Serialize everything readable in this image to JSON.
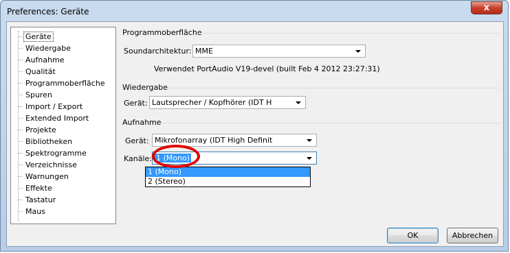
{
  "window": {
    "title": "Preferences: Geräte",
    "close_label": "x"
  },
  "tree": {
    "items": [
      {
        "label": "Geräte"
      },
      {
        "label": "Wiedergabe"
      },
      {
        "label": "Aufnahme"
      },
      {
        "label": "Qualität"
      },
      {
        "label": "Programmoberfläche"
      },
      {
        "label": "Spuren"
      },
      {
        "label": "Import / Export"
      },
      {
        "label": "Extended Import"
      },
      {
        "label": "Projekte"
      },
      {
        "label": "Bibliotheken"
      },
      {
        "label": "Spektrogramme"
      },
      {
        "label": "Verzeichnisse"
      },
      {
        "label": "Warnungen"
      },
      {
        "label": "Effekte"
      },
      {
        "label": "Tastatur"
      },
      {
        "label": "Maus"
      }
    ],
    "selected": "Geräte"
  },
  "interface_group": {
    "title": "Programmoberfläche",
    "host_label": "Soundarchitektur:",
    "host_value": "MME",
    "info": "Verwendet PortAudio V19-devel (built Feb  4 2012 23:27:31)"
  },
  "playback_group": {
    "title": "Wiedergabe",
    "device_label": "Gerät:",
    "device_value": "Lautsprecher / Kopfhörer (IDT H"
  },
  "recording_group": {
    "title": "Aufnahme",
    "device_label": "Gerät:",
    "device_value": "Mikrofonarray (IDT High Definit",
    "channels_label": "Kanäle:",
    "channels_value": "1 (Mono)",
    "channels_options": [
      "1 (Mono)",
      "2 (Stereo)"
    ]
  },
  "buttons": {
    "ok": "OK",
    "cancel": "Abbrechen"
  },
  "colors": {
    "highlight": "#3399ff",
    "annotation_circle": "#e00000"
  }
}
